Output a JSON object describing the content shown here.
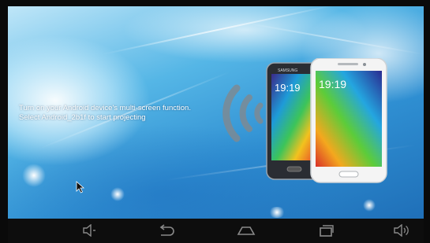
{
  "projection": {
    "instruction_line1": "Turn on your Android device's multi-screen function.",
    "instruction_line2": "Select Android_2b1f to start projecting"
  },
  "phones": {
    "left_phone_brand": "SAMSUNG",
    "left_time": "19:19",
    "right_time": "19:19"
  },
  "colors": {
    "background_top": "#bfe6f8",
    "background_bottom": "#1f6fb8",
    "navbar": "#0d0d0d",
    "nav_icon": "#8a8a8a"
  },
  "navbar": {
    "buttons": [
      "volume-down-icon",
      "back-icon",
      "home-icon",
      "recent-apps-icon",
      "volume-up-icon"
    ]
  }
}
